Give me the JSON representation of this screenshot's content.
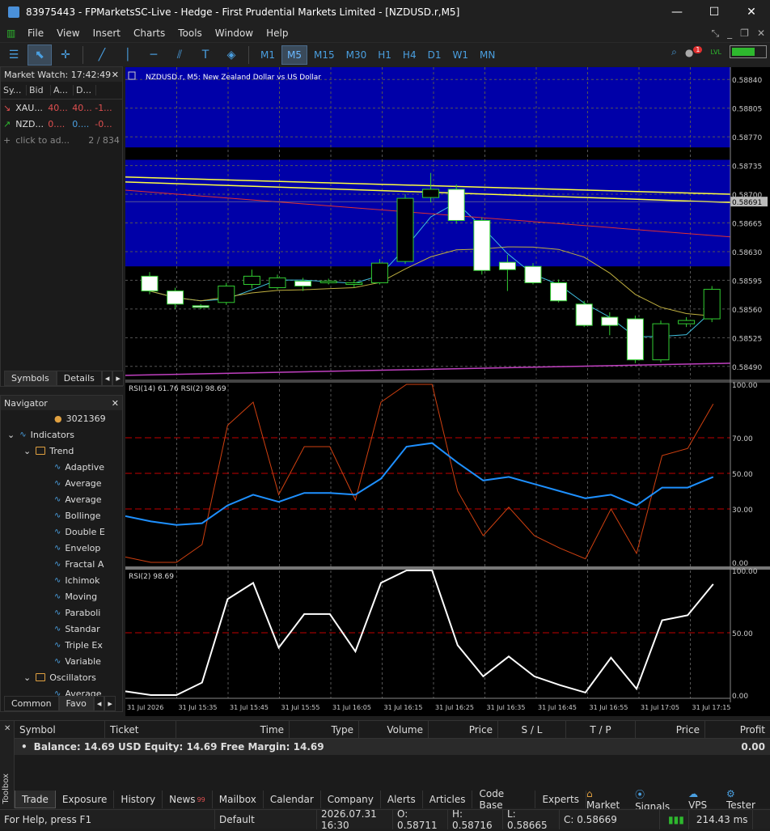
{
  "window": {
    "title": "83975443 - FPMarketsSC-Live - Hedge - First Prudential Markets Limited - [NZDUSD.r,M5]"
  },
  "menu": [
    "File",
    "View",
    "Insert",
    "Charts",
    "Tools",
    "Window",
    "Help"
  ],
  "timeframes": [
    "M1",
    "M5",
    "M15",
    "M30",
    "H1",
    "H4",
    "D1",
    "W1",
    "MN"
  ],
  "active_timeframe": "M5",
  "notification_count": "1",
  "level_label": "LVL",
  "market_watch": {
    "title": "Market Watch: 17:42:49",
    "columns": [
      "Sy...",
      "Bid",
      "A...",
      "D..."
    ],
    "rows": [
      {
        "symbol": "XAU...",
        "bid": "40...",
        "ask": "40...",
        "change": "-1..."
      },
      {
        "symbol": "NZD...",
        "bid": "0....",
        "ask": "0....",
        "change": "-0..."
      }
    ],
    "add_label": "click to ad...",
    "count": "2 / 834",
    "tabs": [
      "Symbols",
      "Details"
    ]
  },
  "navigator": {
    "title": "Navigator",
    "account": "3021369",
    "indicators": "Indicators",
    "trend": "Trend",
    "trend_items": [
      "Adaptive",
      "Average",
      "Average",
      "Bollinge",
      "Double E",
      "Envelop",
      "Fractal A",
      "Ichimok",
      "Moving",
      "Paraboli",
      "Standar",
      "Triple Ex",
      "Variable"
    ],
    "oscillators": "Oscillators",
    "osc_items": [
      "Average"
    ],
    "tabs": [
      "Common",
      "Favo"
    ]
  },
  "chart": {
    "symbol_label": "NZDUSD.r, M5:  New Zealand Dollar vs US Dollar",
    "price_ticks": [
      "0.58840",
      "0.58805",
      "0.58770",
      "0.58735",
      "0.58700",
      "0.58665",
      "0.58630",
      "0.58595",
      "0.58560",
      "0.58525",
      "0.58490"
    ],
    "current_price": "0.58691",
    "rsi_panel_label": "RSI(14) 61.76 RSI(2) 98.69",
    "rsi_ticks": [
      "100.00",
      "70.00",
      "50.00",
      "30.00",
      "0.00"
    ],
    "rsi2_panel_label": "RSI(2) 98.69",
    "rsi2_ticks": [
      "100.00",
      "50.00",
      "0.00"
    ],
    "time_ticks": [
      "31 Jul 2026",
      "31 Jul 15:35",
      "31 Jul 15:45",
      "31 Jul 15:55",
      "31 Jul 16:05",
      "31 Jul 16:15",
      "31 Jul 16:25",
      "31 Jul 16:35",
      "31 Jul 16:45",
      "31 Jul 16:55",
      "31 Jul 17:05",
      "31 Jul 17:15"
    ]
  },
  "chart_data": {
    "type": "candlestick",
    "candles": [
      {
        "o": 0.586,
        "h": 0.58605,
        "l": 0.58578,
        "c": 0.58582
      },
      {
        "o": 0.58582,
        "h": 0.58586,
        "l": 0.5856,
        "c": 0.58566
      },
      {
        "o": 0.58564,
        "h": 0.58566,
        "l": 0.5856,
        "c": 0.58562
      },
      {
        "o": 0.58568,
        "h": 0.58592,
        "l": 0.58565,
        "c": 0.58588
      },
      {
        "o": 0.5859,
        "h": 0.58608,
        "l": 0.58585,
        "c": 0.586
      },
      {
        "o": 0.58586,
        "h": 0.58602,
        "l": 0.58584,
        "c": 0.58598
      },
      {
        "o": 0.58594,
        "h": 0.58598,
        "l": 0.58582,
        "c": 0.58588
      },
      {
        "o": 0.58592,
        "h": 0.58597,
        "l": 0.5859,
        "c": 0.58594
      },
      {
        "o": 0.5859,
        "h": 0.58596,
        "l": 0.58586,
        "c": 0.58592
      },
      {
        "o": 0.58592,
        "h": 0.58621,
        "l": 0.5859,
        "c": 0.58616
      },
      {
        "o": 0.58618,
        "h": 0.587,
        "l": 0.58615,
        "c": 0.58695
      },
      {
        "o": 0.58696,
        "h": 0.58726,
        "l": 0.5869,
        "c": 0.58706
      },
      {
        "o": 0.58706,
        "h": 0.58712,
        "l": 0.58664,
        "c": 0.58668
      },
      {
        "o": 0.58668,
        "h": 0.58672,
        "l": 0.58602,
        "c": 0.58607
      },
      {
        "o": 0.58617,
        "h": 0.58626,
        "l": 0.58582,
        "c": 0.58608
      },
      {
        "o": 0.58612,
        "h": 0.58616,
        "l": 0.5859,
        "c": 0.58592
      },
      {
        "o": 0.58592,
        "h": 0.58596,
        "l": 0.58568,
        "c": 0.5857
      },
      {
        "o": 0.58566,
        "h": 0.5857,
        "l": 0.58538,
        "c": 0.5854
      },
      {
        "o": 0.5855,
        "h": 0.58556,
        "l": 0.58528,
        "c": 0.5854
      },
      {
        "o": 0.58548,
        "h": 0.58552,
        "l": 0.58494,
        "c": 0.58498
      },
      {
        "o": 0.58498,
        "h": 0.58546,
        "l": 0.58495,
        "c": 0.58542
      },
      {
        "o": 0.58542,
        "h": 0.5855,
        "l": 0.58538,
        "c": 0.58546
      },
      {
        "o": 0.58548,
        "h": 0.58588,
        "l": 0.58544,
        "c": 0.58584
      }
    ],
    "rsi14": [
      26,
      23,
      21,
      22,
      32,
      38,
      34,
      39,
      39,
      38,
      47,
      65,
      67,
      56,
      46,
      48,
      44,
      40,
      36,
      38,
      32,
      42,
      42,
      48
    ],
    "rsi2": [
      3,
      0,
      0,
      10,
      77,
      90,
      38,
      65,
      65,
      35,
      90,
      100,
      100,
      40,
      15,
      31,
      15,
      8,
      2,
      30,
      5,
      60,
      64,
      89
    ],
    "rsi_levels": [
      70,
      50,
      30
    ],
    "rsi2_levels": [
      50
    ]
  },
  "toolbox": {
    "side_label": "Toolbox",
    "columns": [
      "Symbol",
      "Ticket",
      "Time",
      "Type",
      "Volume",
      "Price",
      "S / L",
      "T / P",
      "Price",
      "Profit"
    ],
    "balance_text": "Balance: 14.69 USD  Equity: 14.69  Free Margin: 14.69",
    "profit": "0.00",
    "tabs": [
      "Trade",
      "Exposure",
      "History",
      "News",
      "Mailbox",
      "Calendar",
      "Company",
      "Alerts",
      "Articles",
      "Code Base",
      "Experts"
    ],
    "news_badge": "99",
    "right_tabs": [
      "Market",
      "Signals",
      "VPS",
      "Tester"
    ]
  },
  "status": {
    "help": "For Help, press F1",
    "profile": "Default",
    "datetime": "2026.07.31 16:30",
    "open": "O: 0.58711",
    "high": "H: 0.58716",
    "low": "L: 0.58665",
    "close": "C: 0.58669",
    "ping": "214.43 ms"
  },
  "colors": {
    "bull": "#32cd32",
    "bear_fill": "#ffffff",
    "band": "#0000a8",
    "rsi14": "#1e90ff",
    "rsi2": "#d04010",
    "level": "#c00000"
  }
}
